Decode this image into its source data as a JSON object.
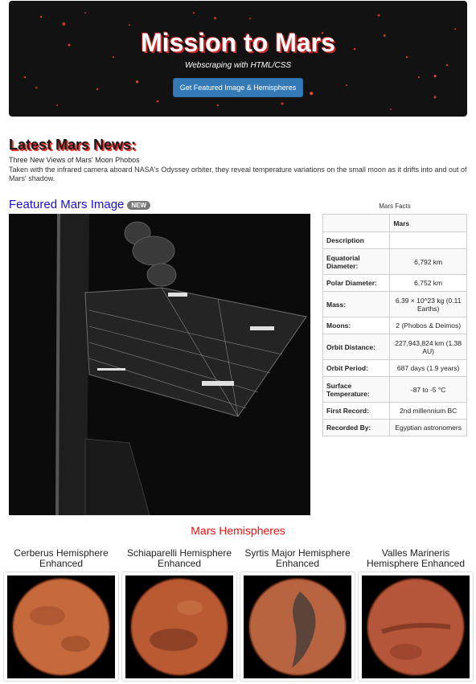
{
  "jumbotron": {
    "title": "Mission to Mars",
    "subtitle": "Webscraping with HTML/CSS",
    "button_label": "Get Featured Image & Hemispheres"
  },
  "news": {
    "section_title": "Latest Mars News:",
    "headline": "Three New Views of Mars' Moon Phobos",
    "body": "Taken with the infrared camera aboard NASA's Odyssey orbiter, they reveal temperature variations on the small moon as it drifts into and out of Mars' shadow."
  },
  "featured": {
    "title": "Featured Mars Image",
    "badge": "NEW"
  },
  "facts": {
    "caption": "Mars Facts",
    "header": [
      "",
      "Mars"
    ],
    "rows": [
      {
        "label": "Description",
        "value": ""
      },
      {
        "label": "Equatorial Diameter:",
        "value": "6,792 km"
      },
      {
        "label": "Polar Diameter:",
        "value": "6,752 km"
      },
      {
        "label": "Mass:",
        "value": "6.39 × 10^23 kg (0.11 Earths)"
      },
      {
        "label": "Moons:",
        "value": "2 (Phobos & Deimos)"
      },
      {
        "label": "Orbit Distance:",
        "value": "227,943,824 km (1.38 AU)"
      },
      {
        "label": "Orbit Period:",
        "value": "687 days (1.9 years)"
      },
      {
        "label": "Surface Temperature:",
        "value": "-87 to -5 °C"
      },
      {
        "label": "First Record:",
        "value": "2nd millennium BC"
      },
      {
        "label": "Recorded By:",
        "value": "Egyptian astronomers"
      }
    ]
  },
  "hemispheres": {
    "section_title": "Mars Hemispheres",
    "items": [
      {
        "name": "Cerberus Hemisphere Enhanced",
        "color": "#c66a3e"
      },
      {
        "name": "Schiaparelli Hemisphere Enhanced",
        "color": "#b95a33"
      },
      {
        "name": "Syrtis Major Hemisphere Enhanced",
        "color": "#b86440"
      },
      {
        "name": "Valles Marineris Hemisphere Enhanced",
        "color": "#b5553a"
      }
    ]
  },
  "colors": {
    "accent_blue": "#337ab7",
    "featured_title": "#1a0dd0",
    "hemi_title": "#e8110f"
  }
}
